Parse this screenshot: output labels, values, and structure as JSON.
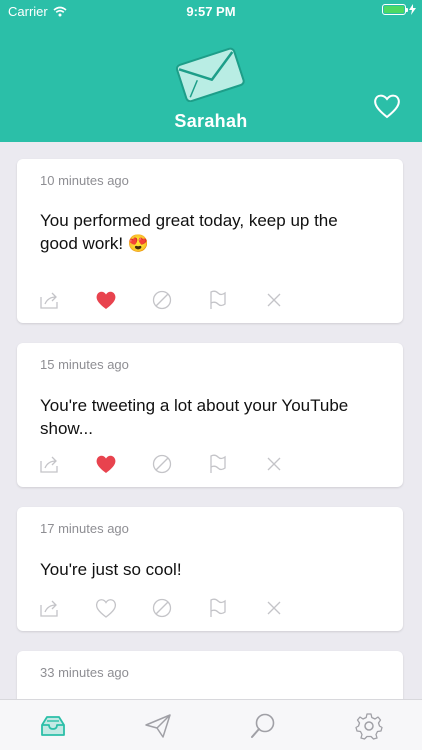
{
  "status_bar": {
    "carrier": "Carrier",
    "time": "9:57 PM"
  },
  "header": {
    "title": "Sarahah",
    "logo_icon": "envelope-icon",
    "favorites_icon": "heart-outline-icon"
  },
  "messages": [
    {
      "time": "10 minutes ago",
      "text": "You performed great today, keep up the good work! 😍",
      "liked": true
    },
    {
      "time": "15 minutes ago",
      "text": "You're tweeting a lot about your YouTube show...",
      "liked": true
    },
    {
      "time": "17 minutes ago",
      "text": "You're just so cool!",
      "liked": false
    },
    {
      "time": "33 minutes ago",
      "text": "",
      "liked": false
    }
  ],
  "message_actions": [
    "share-icon",
    "heart-icon",
    "block-icon",
    "flag-icon",
    "delete-icon"
  ],
  "tabbar": {
    "tabs": [
      "inbox-icon",
      "send-icon",
      "search-icon",
      "settings-icon"
    ]
  },
  "colors": {
    "brand": "#2bbfa8",
    "like": "#e8434e",
    "icon_gray": "#c4c4c8",
    "background": "#ebeaf0"
  }
}
